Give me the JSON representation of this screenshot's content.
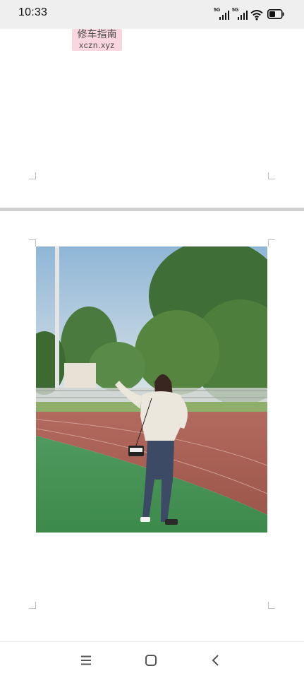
{
  "status_bar": {
    "time": "10:33",
    "signal_1_label": "5G",
    "signal_2_label": "5G",
    "icons": [
      "signal-icon",
      "signal-icon",
      "wifi-icon",
      "battery-icon"
    ]
  },
  "document": {
    "watermark": {
      "chinese_text": "修车指南",
      "url_text": "xczn.xyz",
      "background_color": "#f9d6e0"
    },
    "photo": {
      "subject": "woman in cream sweater and jeans posing on running track"
    }
  },
  "nav_bar": {
    "icons": [
      "menu-icon",
      "home-icon",
      "back-icon"
    ]
  }
}
